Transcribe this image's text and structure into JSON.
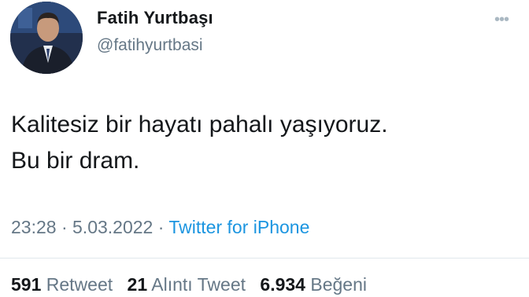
{
  "tweet": {
    "display_name": "Fatih Yurtbaşı",
    "handle": "@fatihyurtbasi",
    "more_icon": "more-options-icon",
    "text": "Kalitesiz bir hayatı pahalı yaşıyoruz.\nBu bir dram.",
    "time": "23:28",
    "separator1": "·",
    "date": "5.03.2022",
    "separator2": "·",
    "source": "Twitter for iPhone",
    "accent_color": "#1b95e0"
  },
  "stats": {
    "retweets_count": "591",
    "retweets_label": "Retweet",
    "quotes_count": "21",
    "quotes_label": "Alıntı Tweet",
    "likes_count": "6.934",
    "likes_label": "Beğeni"
  }
}
